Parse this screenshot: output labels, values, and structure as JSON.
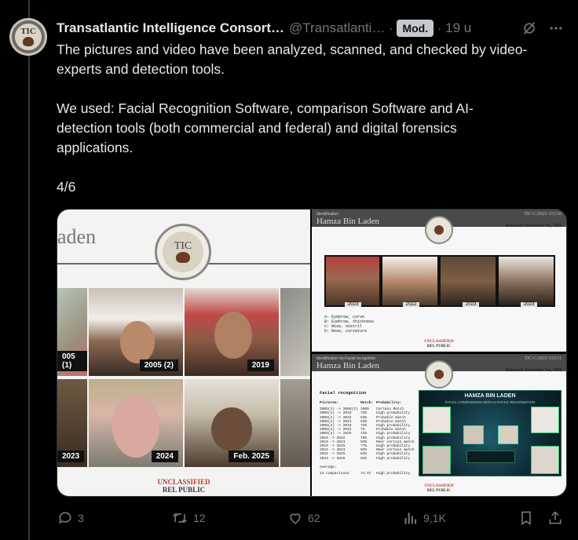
{
  "post": {
    "author_name": "Transatlantic Intelligence Consort…",
    "author_handle": "@Transatlanti…",
    "badge": "Mod.",
    "separator": "·",
    "time": "19 u",
    "paragraphs": [
      "The pictures and video have been analyzed, scanned, and checked by video-experts and detection tools.",
      "We used: Facial Recognition Software, comparison Software and AI-detection tools (both commercial and federal) and digital forensics applications.",
      "4/6"
    ],
    "header_icons": [
      "grok-icon",
      "more-icon"
    ]
  },
  "media": {
    "left": {
      "title": "aden",
      "seal_text": "TIC",
      "labels": [
        "005 (1)",
        "2005 (2)",
        "2019",
        "2023",
        "2024",
        "Feb. 2025"
      ],
      "footer_top": "UNCLASSIFIED",
      "footer_bottom": "REL PUBLIC"
    },
    "slide1": {
      "header_small": "Identification",
      "header_name": "Hamza Bin Laden",
      "ref": "TIC-C/2025-115/10",
      "released": "Released: December 1st, 2025",
      "photo_labels": [
        "2023",
        "2022",
        "2023",
        "2023"
      ],
      "legend": [
        "A: Eyebrow, curve",
        "B: Eyebrow, thickness",
        "C: Nose, nostril",
        "D: Nose, curvature"
      ],
      "footer": "UNCLASSIFIED",
      "footer2": "REL PUBLIC"
    },
    "slide2": {
      "header_small": "Identification by Facial recognition",
      "header_name": "Hamza Bin Laden",
      "ref": "TIC-C/2025-115/11",
      "released": "Released: December 1st, 2025",
      "section": "Facial recognition",
      "columns": [
        "Pictures:",
        "Match:",
        "Probability:"
      ],
      "rows": [
        [
          "2005(1) -> 2005(2)",
          "100%",
          "Certain Match"
        ],
        [
          "2005(1) -> 2019",
          "73%",
          "High probability"
        ],
        [
          "2005(1) -> 2022",
          "63%",
          "Probable match"
        ],
        [
          "2005(1) -> 2023",
          "63%",
          "Probable match"
        ],
        [
          "2005(2) -> 2019",
          "72%",
          "High probability"
        ],
        [
          "2005(2) -> 2022",
          "7%",
          "Probable match"
        ],
        [
          "2005(2) -> 2025",
          "72%",
          "High probability"
        ],
        [
          "2019 -> 2022",
          "79%",
          "High probability"
        ],
        [
          "2019 -> 2023",
          "93%",
          "Near certain match"
        ],
        [
          "2019 -> 2025",
          "77%",
          "High probability"
        ],
        [
          "2022 -> 2023",
          "92%",
          "Near certain match"
        ],
        [
          "2022 -> 2025",
          "84%",
          "High probability"
        ],
        [
          "2023 -> 2025",
          "82%",
          "High probability"
        ]
      ],
      "average_label": "Average:",
      "total": [
        "13 comparisons",
        "74.57",
        "High probability"
      ],
      "graphic_title": "HAMZA BIN LADEN",
      "graphic_subtitle": "FACIAL COMPARISON WITH AI FACIAL RECOGNITION",
      "footer": "UNCLASSIFIED",
      "footer2": "REL PUBLIC"
    }
  },
  "actions": {
    "replies": "3",
    "reposts": "12",
    "likes": "62",
    "views": "9,1K"
  }
}
